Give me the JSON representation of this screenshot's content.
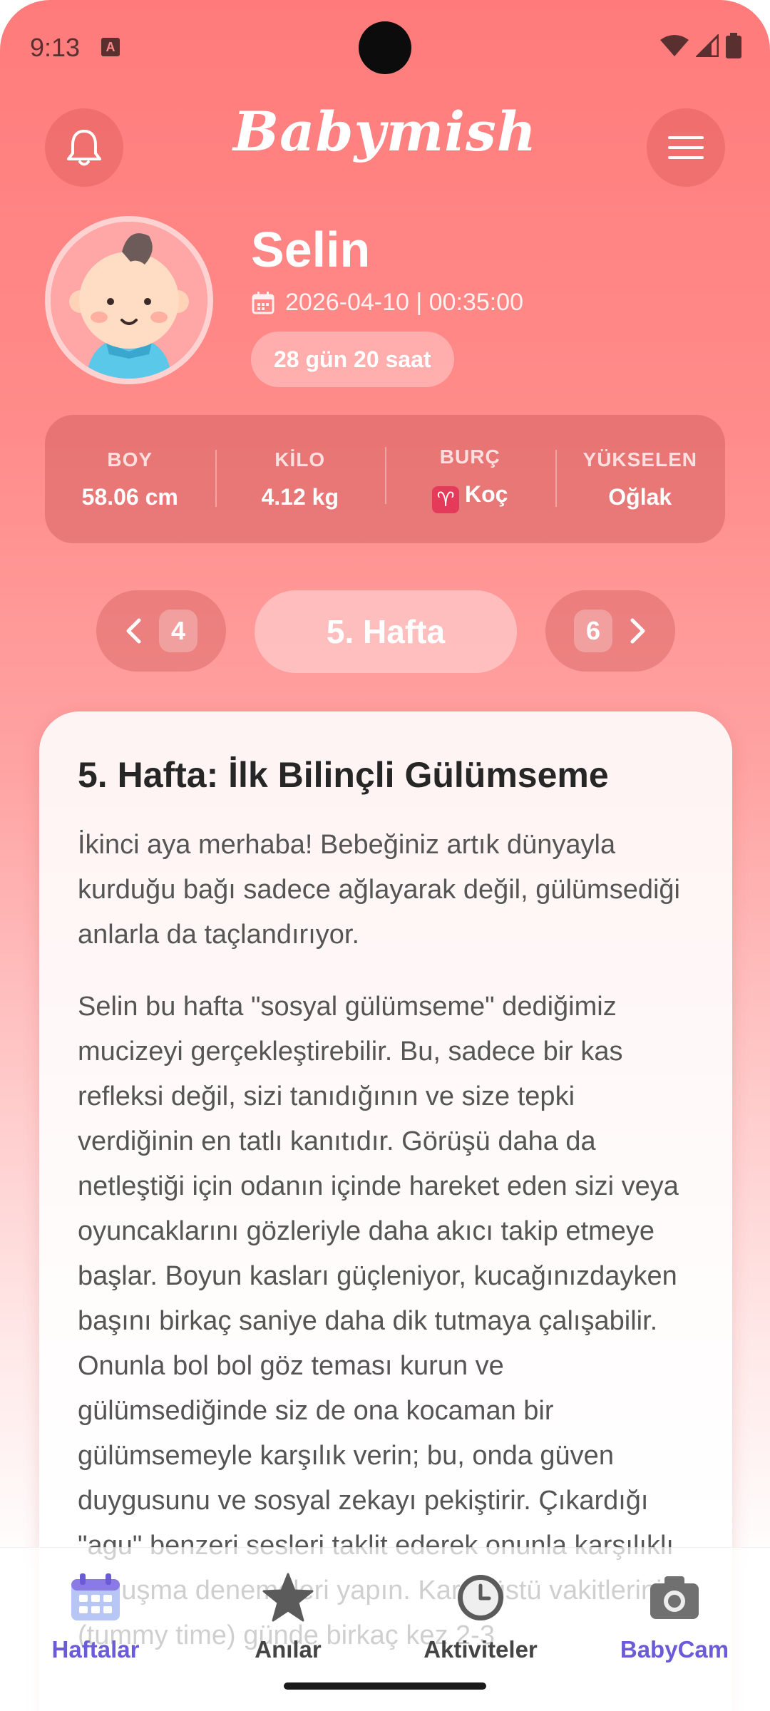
{
  "status_bar": {
    "time": "9:13",
    "notification_glyph": "A"
  },
  "header": {
    "brand": "Babymish"
  },
  "profile": {
    "name": "Selin",
    "birth": "2026-04-10 | 00:35:00",
    "age": "28 gün 20 saat"
  },
  "stats": [
    {
      "label": "BOY",
      "value": "58.06 cm"
    },
    {
      "label": "KİLO",
      "value": "4.12 kg"
    },
    {
      "label": "BURÇ",
      "value": "Koç",
      "icon": "♈"
    },
    {
      "label": "YÜKSELEN",
      "value": "Oğlak"
    }
  ],
  "week_nav": {
    "prev": "4",
    "current": "5. Hafta",
    "next": "6"
  },
  "article": {
    "title": "5. Hafta: İlk Bilinçli Gülümseme",
    "paragraphs": [
      "İkinci aya merhaba! Bebeğiniz artık dünyayla kurduğu bağı sadece ağlayarak değil, gülümsediği anlarla da taçlandırıyor.",
      "Selin bu hafta \"sosyal gülümseme\" dediğimiz mucizeyi gerçekleştirebilir. Bu, sadece bir kas refleksi değil, sizi tanıdığının ve size tepki verdiğinin en tatlı kanıtıdır. Görüşü daha da netleştiği için odanın içinde hareket eden sizi veya oyuncaklarını gözleriyle daha akıcı takip etmeye başlar. Boyun kasları güçleniyor, kucağınızdayken başını birkaç saniye daha dik tutmaya çalışabilir.",
      "Onunla bol bol göz teması kurun ve gülümsediğinde siz de ona kocaman bir gülümsemeyle karşılık verin; bu, onda güven duygusunu ve sosyal zekayı pekiştirir. Çıkardığı \"agu\" benzeri sesleri taklit ederek onunla karşılıklı konuşma denemeleri yapın. Karın üstü vakitlerini (tummy time) günde birkaç kez 2-3"
    ]
  },
  "bottom_nav": [
    {
      "label": "Haftalar",
      "icon": "calendar-icon",
      "active": true
    },
    {
      "label": "Anılar",
      "icon": "star-icon",
      "active": false
    },
    {
      "label": "Aktiviteler",
      "icon": "clock-icon",
      "active": false
    },
    {
      "label": "BabyCam",
      "icon": "camera-icon",
      "active": true
    }
  ],
  "colors": {
    "accent": "#6b5bd6",
    "gradient_top": "#ff7b7b",
    "gradient_bottom": "#ffffff",
    "inactive_nav": "#444444"
  }
}
